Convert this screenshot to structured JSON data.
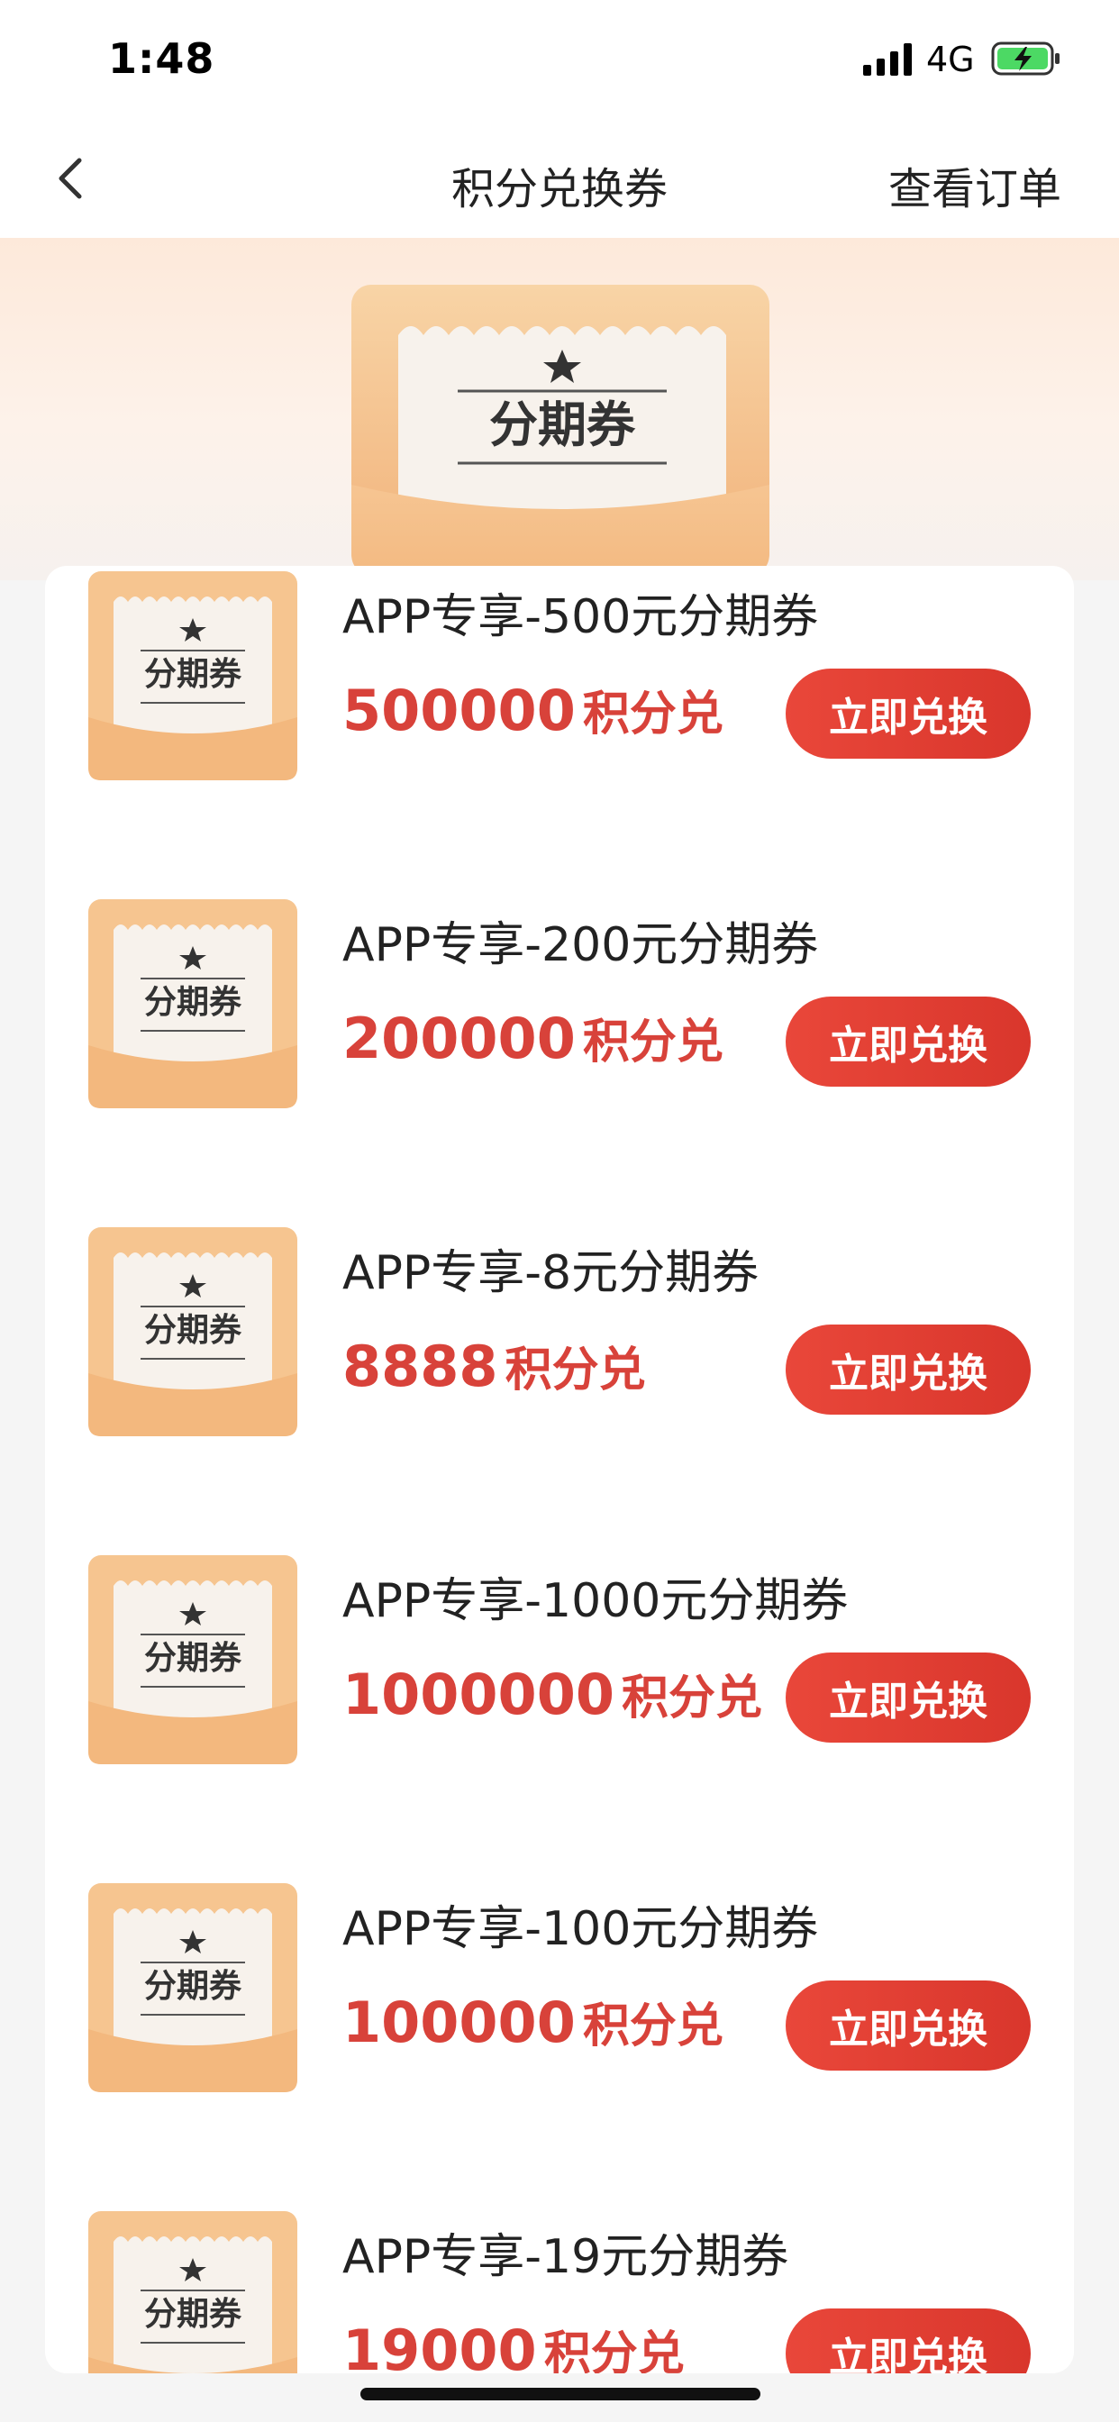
{
  "status_bar": {
    "time": "1:48",
    "network": "4G"
  },
  "nav": {
    "title": "积分兑换券",
    "action": "查看订单"
  },
  "banner": {
    "coupon_label": "分期券"
  },
  "items": [
    {
      "title": "APP专享-500元分期券",
      "points": "500000",
      "unit": "积分兑",
      "button": "立即兑换",
      "thumb_label": "分期券"
    },
    {
      "title": "APP专享-200元分期券",
      "points": "200000",
      "unit": "积分兑",
      "button": "立即兑换",
      "thumb_label": "分期券"
    },
    {
      "title": "APP专享-8元分期券",
      "points": "8888",
      "unit": "积分兑",
      "button": "立即兑换",
      "thumb_label": "分期券"
    },
    {
      "title": "APP专享-1000元分期券",
      "points": "1000000",
      "unit": "积分兑",
      "button": "立即兑换",
      "thumb_label": "分期券"
    },
    {
      "title": "APP专享-100元分期券",
      "points": "100000",
      "unit": "积分兑",
      "button": "立即兑换",
      "thumb_label": "分期券"
    },
    {
      "title": "APP专享-19元分期券",
      "points": "19000",
      "unit": "积分兑",
      "button": "立即兑换",
      "thumb_label": "分期券"
    }
  ],
  "colors": {
    "accent_red": "#d8423a",
    "button_red": "#e9473a",
    "coupon_orange": "#f4c08f"
  }
}
